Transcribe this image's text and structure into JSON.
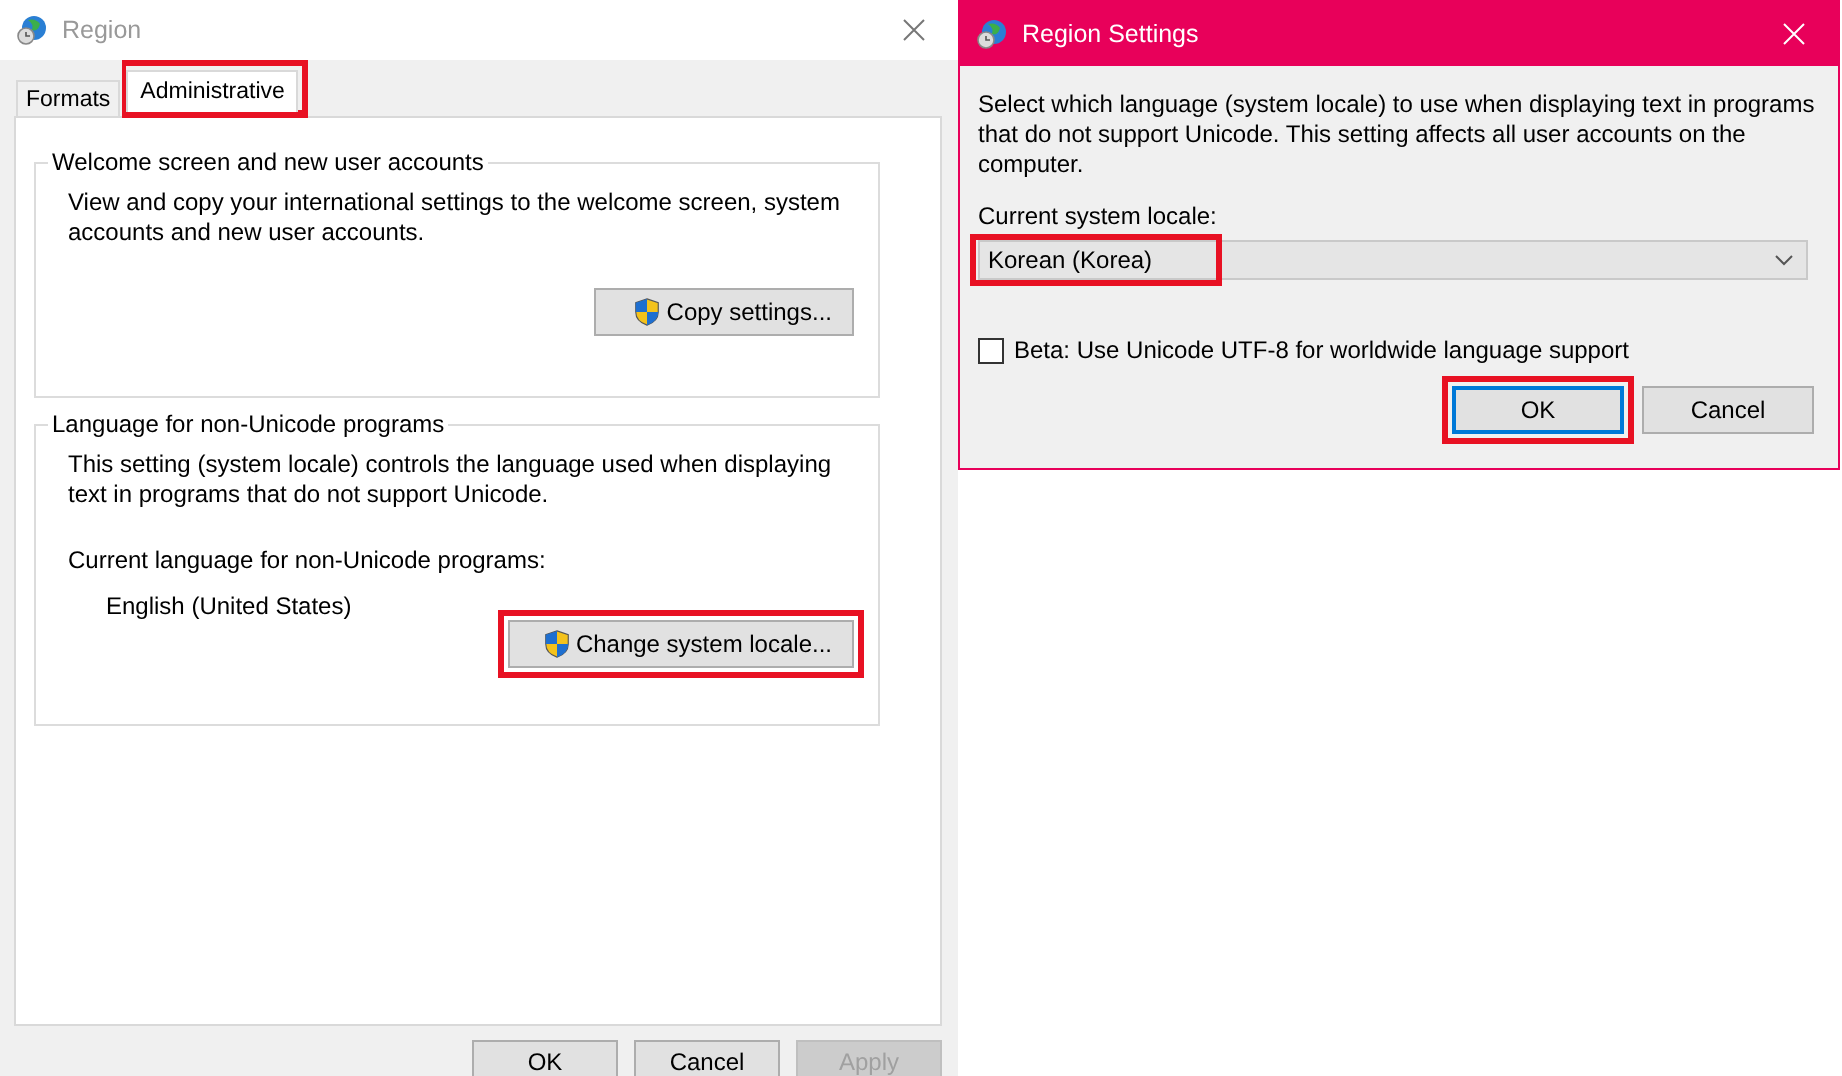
{
  "region_window": {
    "title": "Region",
    "tabs": [
      {
        "label": "Formats",
        "selected": false,
        "highlighted": false
      },
      {
        "label": "Administrative",
        "selected": true,
        "highlighted": true
      }
    ],
    "groups": [
      {
        "title": "Welcome screen and new user accounts",
        "description": "View and copy your international settings to the welcome screen, system accounts and new user accounts.",
        "button": {
          "label": "Copy settings...",
          "highlighted": false
        }
      },
      {
        "title": "Language for non-Unicode programs",
        "description": "This setting (system locale) controls the language used when displaying text in programs that do not support Unicode.",
        "current_label": "Current language for non-Unicode programs:",
        "current_value": "English (United States)",
        "button": {
          "label": "Change system locale...",
          "highlighted": true
        }
      }
    ],
    "buttons": [
      {
        "label": "OK",
        "disabled": false
      },
      {
        "label": "Cancel",
        "disabled": false
      },
      {
        "label": "Apply",
        "disabled": true
      }
    ]
  },
  "settings_dialog": {
    "title": "Region Settings",
    "description": "Select which language (system locale) to use when displaying text in programs that do not support Unicode. This setting affects all user accounts on the computer.",
    "locale_label": "Current system locale:",
    "locale": {
      "value": "Korean (Korea)",
      "highlighted": true
    },
    "beta_checkbox": {
      "label": "Beta: Use Unicode UTF-8 for worldwide language support",
      "checked": false
    },
    "buttons": [
      {
        "label": "OK",
        "default": true,
        "highlighted": true
      },
      {
        "label": "Cancel",
        "default": false,
        "highlighted": false
      }
    ]
  }
}
